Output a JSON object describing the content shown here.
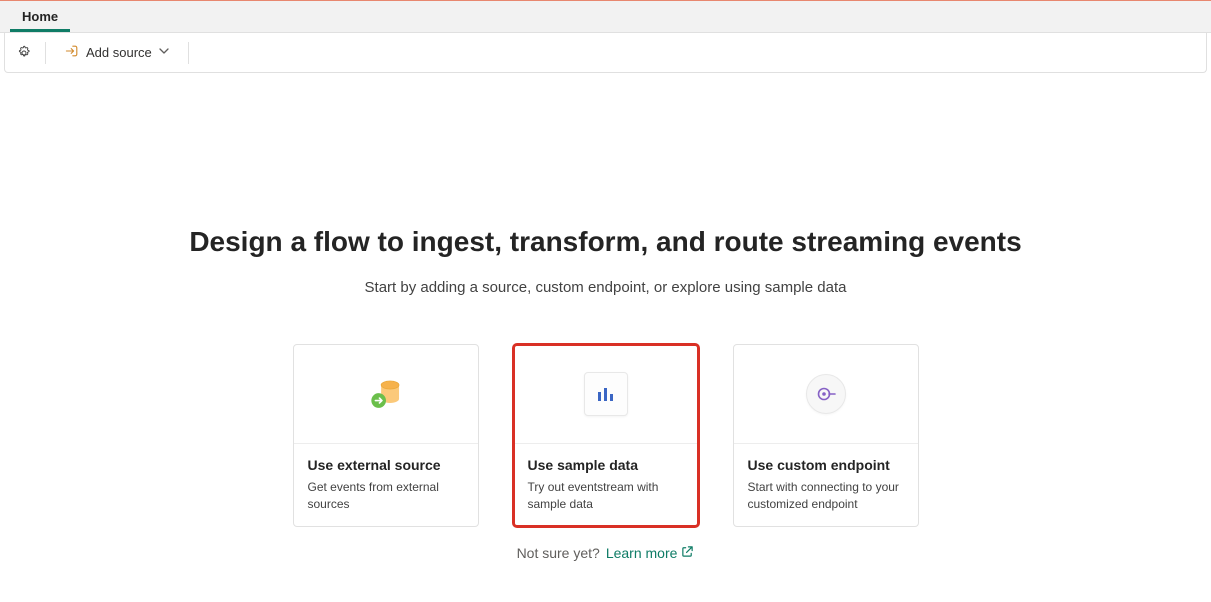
{
  "tabs": [
    {
      "label": "Home",
      "active": true
    }
  ],
  "toolbar": {
    "add_source_label": "Add source"
  },
  "heading": "Design a flow to ingest, transform, and route streaming events",
  "subheading": "Start by adding a source, custom endpoint, or explore using sample data",
  "cards": [
    {
      "title": "Use external source",
      "desc": "Get events from external sources",
      "selected": false
    },
    {
      "title": "Use sample data",
      "desc": "Try out eventstream with sample data",
      "selected": true
    },
    {
      "title": "Use custom endpoint",
      "desc": "Start with connecting to your customized endpoint",
      "selected": false
    }
  ],
  "footer": {
    "not_sure": "Not sure yet?",
    "learn_more": "Learn more"
  }
}
